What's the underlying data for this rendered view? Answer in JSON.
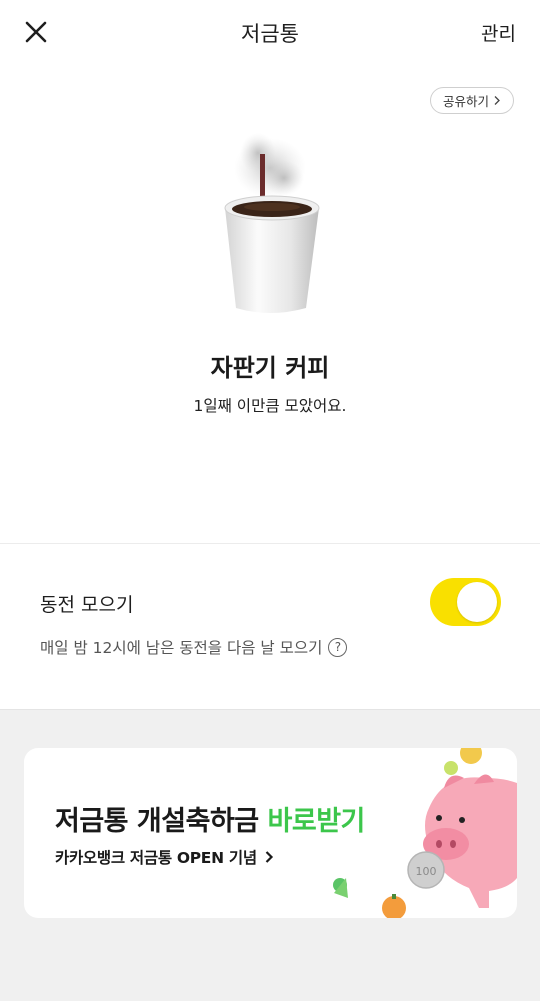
{
  "header": {
    "title": "저금통",
    "manage_label": "관리",
    "close_icon": "close-icon"
  },
  "share": {
    "label": "공유하기"
  },
  "goal": {
    "image_icon": "coffee-cup-icon",
    "title": "자판기 커피",
    "subtitle": "1일째 이만큼 모았어요."
  },
  "coin_saving": {
    "title": "동전 모으기",
    "description": "매일 밤 12시에 남은 동전을 다음 날 모으기",
    "enabled": true
  },
  "banner": {
    "main_prefix": "저금통 개설축하금 ",
    "main_highlight": "바로받기",
    "sub": "카카오뱅크 저금통 OPEN 기념",
    "coin_text": "100"
  },
  "colors": {
    "accent_yellow": "#f9e000",
    "highlight_green": "#3cc64b",
    "pig_pink": "#f7a9b8"
  }
}
